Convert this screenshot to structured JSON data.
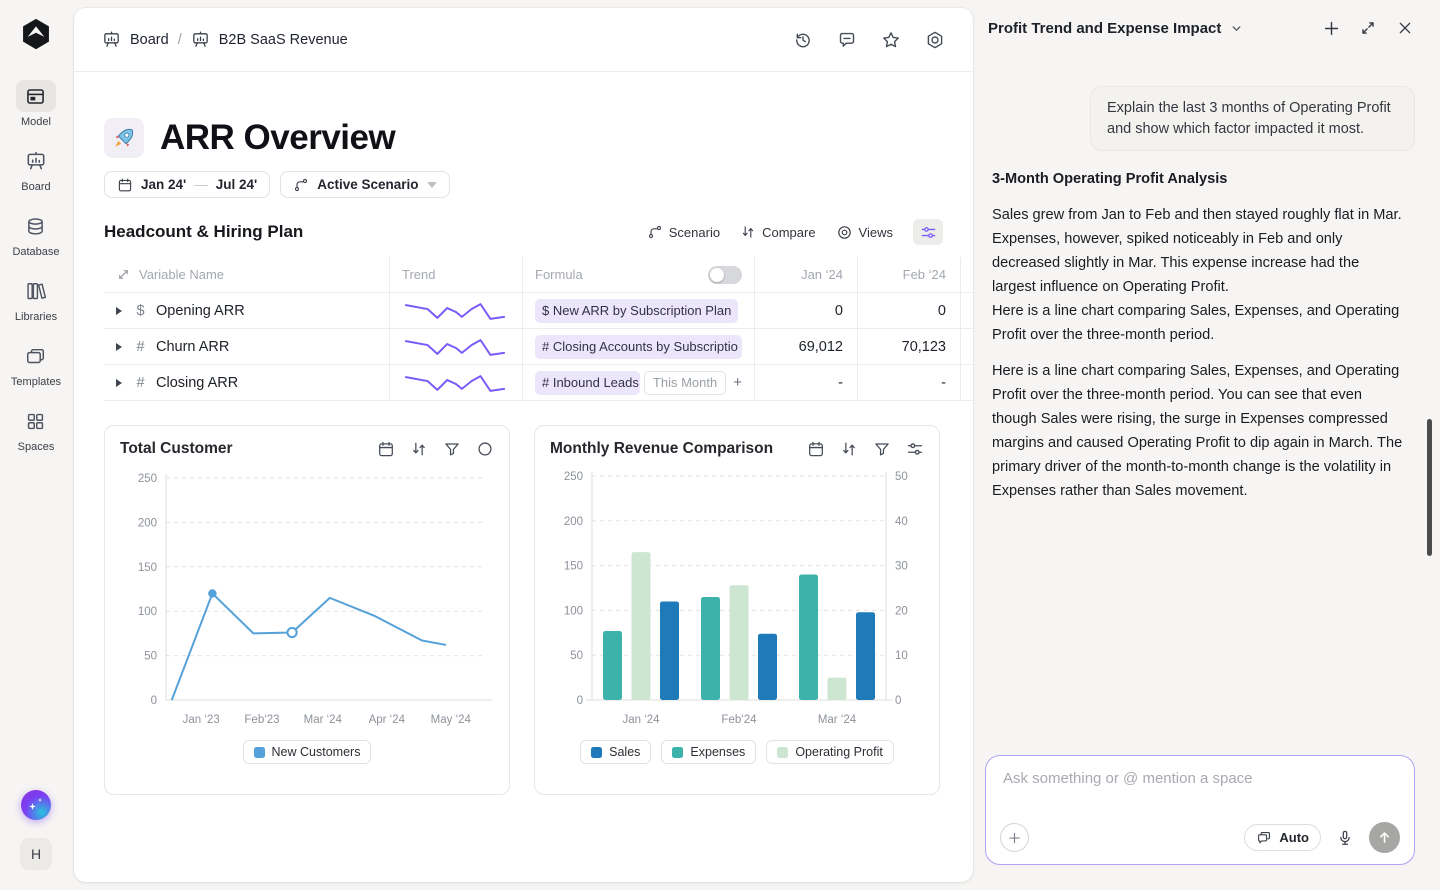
{
  "colors": {
    "accent_purple": "#7a5af8",
    "sales_blue": "#1e7ab8",
    "expenses_teal": "#3cb2aa",
    "profit_green": "#cde6d2",
    "line_blue": "#55a1da"
  },
  "sidebar": {
    "items": [
      {
        "id": "model",
        "label": "Model",
        "active": true
      },
      {
        "id": "board",
        "label": "Board",
        "active": false
      },
      {
        "id": "database",
        "label": "Database",
        "active": false
      },
      {
        "id": "libraries",
        "label": "Libraries",
        "active": false
      },
      {
        "id": "templates",
        "label": "Templates",
        "active": false
      },
      {
        "id": "spaces",
        "label": "Spaces",
        "active": false
      }
    ],
    "ai_button_icon": "sparkle",
    "avatar_label": "H"
  },
  "header": {
    "breadcrumb": [
      "Board",
      "B2B SaaS Revenue"
    ],
    "action_icons": [
      "history",
      "comment",
      "star",
      "settings"
    ]
  },
  "page": {
    "emoji": "🚀",
    "title": "ARR Overview",
    "date_start": "Jan 24'",
    "date_end": "Jul 24'",
    "scenario": "Active Scenario"
  },
  "section": {
    "title": "Headcount & Hiring Plan",
    "buttons": [
      "Scenario",
      "Compare",
      "Views"
    ],
    "filter_icon": "sliders"
  },
  "table": {
    "columns": [
      "Variable Name",
      "Trend",
      "Formula",
      "Jan ‘24",
      "Feb ‘24"
    ],
    "formula_toggle_state": "off",
    "rows": [
      {
        "type": "$",
        "name": "Opening ARR",
        "formula_pill": "$ New ARR by Subscription Plan",
        "values": [
          "0",
          "0"
        ]
      },
      {
        "type": "#",
        "name": "Churn ARR",
        "formula_pill": "# Closing Accounts by Subscriptio",
        "values": [
          "69,012",
          "70,123"
        ]
      },
      {
        "type": "#",
        "name": "Closing ARR",
        "formula_pill": "# Inbound Leads",
        "formula_secondary": "This Month",
        "formula_plus": "+",
        "values": [
          "-",
          "-"
        ]
      }
    ]
  },
  "chart_data": [
    {
      "id": "total-customer",
      "type": "line",
      "title": "Total Customer",
      "toolbar_icons": [
        "calendar",
        "compare",
        "filter",
        "circle"
      ],
      "x_labels": [
        "Jan ‘23",
        "Feb‘23",
        "Mar ‘24",
        "Apr ‘24",
        "May ‘24"
      ],
      "x_label_fracs": [
        0.11,
        0.3,
        0.49,
        0.69,
        0.89
      ],
      "ylim": [
        0,
        250
      ],
      "yticks": [
        0,
        50,
        100,
        150,
        200,
        250
      ],
      "grid": "dashed",
      "legend": [
        "New Customers"
      ],
      "legend_position": "bottom",
      "series": [
        {
          "name": "New Customers",
          "color": "#55a1da",
          "x_fracs": [
            0.018,
            0.145,
            0.273,
            0.394,
            0.512,
            0.65,
            0.8,
            0.875
          ],
          "values": [
            0,
            120,
            75,
            76,
            115,
            95,
            67,
            62
          ],
          "markers": [
            {
              "index": 1,
              "style": "filled"
            },
            {
              "index": 3,
              "style": "open"
            }
          ]
        }
      ]
    },
    {
      "id": "monthly-revenue",
      "type": "bar",
      "title": "Monthly Revenue Comparison",
      "toolbar_icons": [
        "calendar",
        "compare",
        "filter",
        "sliders"
      ],
      "categories": [
        "Jan ‘24",
        "Feb‘24",
        "Mar ‘24"
      ],
      "bar_order": [
        "Expenses",
        "Operating Profit",
        "Sales"
      ],
      "ylim_left": [
        0,
        250
      ],
      "yticks_left": [
        0,
        50,
        100,
        150,
        200,
        250
      ],
      "ylim_right": [
        0,
        50
      ],
      "yticks_right": [
        0,
        10,
        20,
        30,
        40,
        50
      ],
      "grid": "dashed",
      "legend": [
        "Sales",
        "Expenses",
        "Operating Profit"
      ],
      "legend_position": "bottom",
      "series": [
        {
          "name": "Sales",
          "color": "#1e7ab8",
          "values": [
            110,
            74,
            98
          ]
        },
        {
          "name": "Expenses",
          "color": "#3cb2aa",
          "values": [
            77,
            115,
            140
          ]
        },
        {
          "name": "Operating Profit",
          "color": "#cde6d2",
          "values": [
            165,
            128,
            25
          ]
        }
      ]
    }
  ],
  "chat": {
    "title": "Profit Trend and Expense Impact",
    "header_icons": [
      "add",
      "expand",
      "close"
    ],
    "user_message": "Explain the last 3 months of Operating Profit and show which factor impacted it most.",
    "response_heading": "3-Month Operating Profit Analysis",
    "response_paragraphs": [
      " Sales grew from Jan to Feb and then stayed roughly flat in Mar. Expenses, however, spiked noticeably in Feb and only decreased slightly in Mar. This expense increase had the largest influence on Operating Profit.\nHere is a line chart comparing Sales, Expenses, and Operating Profit over the three-month period.",
      "Here is a line chart comparing Sales, Expenses, and Operating Profit over the three-month period. You can see that even though Sales were rising, the surge in Expenses compressed margins and caused Operating Profit to dip again in March. The primary driver of the month-to-month change is the volatility in Expenses rather than Sales movement."
    ]
  },
  "composer": {
    "placeholder": "Ask something or @ mention a space",
    "mode_label": "Auto",
    "icons": [
      "attach-plus",
      "auto-mode",
      "mic",
      "send"
    ]
  }
}
